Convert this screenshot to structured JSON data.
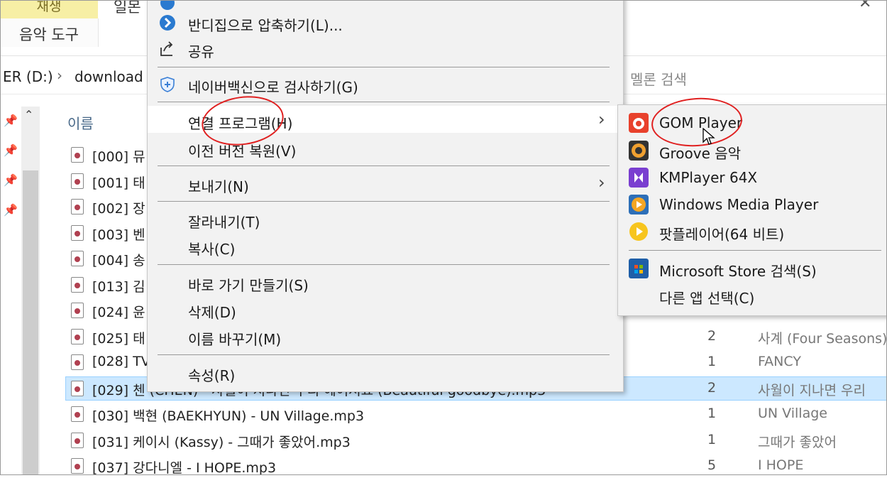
{
  "ribbon": {
    "tab_play": "재생",
    "tab_music_tools": "음악 도구",
    "tab_partial": "일몬",
    "close_glyph": "✕"
  },
  "address": {
    "drive": "ER (D:)",
    "separator": "›",
    "folder": "download",
    "search_placeholder": "멜론 검색"
  },
  "columns": {
    "name": "이름"
  },
  "files": [
    {
      "name": "[000] 뮤",
      "num": "",
      "title": ""
    },
    {
      "name": "[001] 태",
      "num": "",
      "title": ""
    },
    {
      "name": "[002] 장",
      "num": "",
      "title": ""
    },
    {
      "name": "[003] 벤",
      "num": "",
      "title": ""
    },
    {
      "name": "[004] 송",
      "num": "",
      "title": ""
    },
    {
      "name": "[013] 김",
      "num": "",
      "title": ""
    },
    {
      "name": "[024] 윤",
      "num": "",
      "title": ""
    },
    {
      "name": "[025] 태",
      "num": "2",
      "title": "사계 (Four Seasons)"
    },
    {
      "name": "[028] TV",
      "num": "1",
      "title": "FANCY"
    },
    {
      "name": "[029] 첸 (CHEN) - 사월이 지나면 우리 헤어져요 (Beautiful goodbye).mp3",
      "num": "2",
      "title": "사월이 지나면 우리"
    },
    {
      "name": "[030] 백현 (BAEKHYUN) - UN Village.mp3",
      "num": "1",
      "title": "UN Village"
    },
    {
      "name": "[031] 케이시 (Kassy) - 그때가 좋았어.mp3",
      "num": "1",
      "title": "그때가 좋았어"
    },
    {
      "name": "[037] 강다니엘 - I HOPE.mp3",
      "num": "5",
      "title": "I HOPE"
    }
  ],
  "context_menu": {
    "compress": "반디집으로 압축하기(L)...",
    "share": "공유",
    "naver_scan": "네이버백신으로 검사하기(G)",
    "open_with": "연결 프로그램(H)",
    "restore": "이전 버전 복원(V)",
    "send_to": "보내기(N)",
    "cut": "잘라내기(T)",
    "copy": "복사(C)",
    "shortcut": "바로 가기 만들기(S)",
    "delete": "삭제(D)",
    "rename": "이름 바꾸기(M)",
    "properties": "속성(R)"
  },
  "submenu": {
    "gom": "GOM Player",
    "groove": "Groove 음악",
    "kmplayer": "KMPlayer 64X",
    "wmp": "Windows Media Player",
    "potplayer": "팟플레이어(64 비트)",
    "store": "Microsoft Store 검색(S)",
    "other": "다른 앱 선택(C)"
  },
  "icons": {
    "compress": "bandizip-icon",
    "share": "share-icon",
    "naver": "shield-icon",
    "gom": "gom-player-icon",
    "groove": "groove-music-icon",
    "kmplayer": "kmplayer-icon",
    "wmp": "windows-media-player-icon",
    "potplayer": "potplayer-icon",
    "store": "microsoft-store-icon"
  },
  "colors": {
    "highlight": "#cce8ff",
    "annotation": "#e02020",
    "menu_bg": "#f2f2f2"
  }
}
